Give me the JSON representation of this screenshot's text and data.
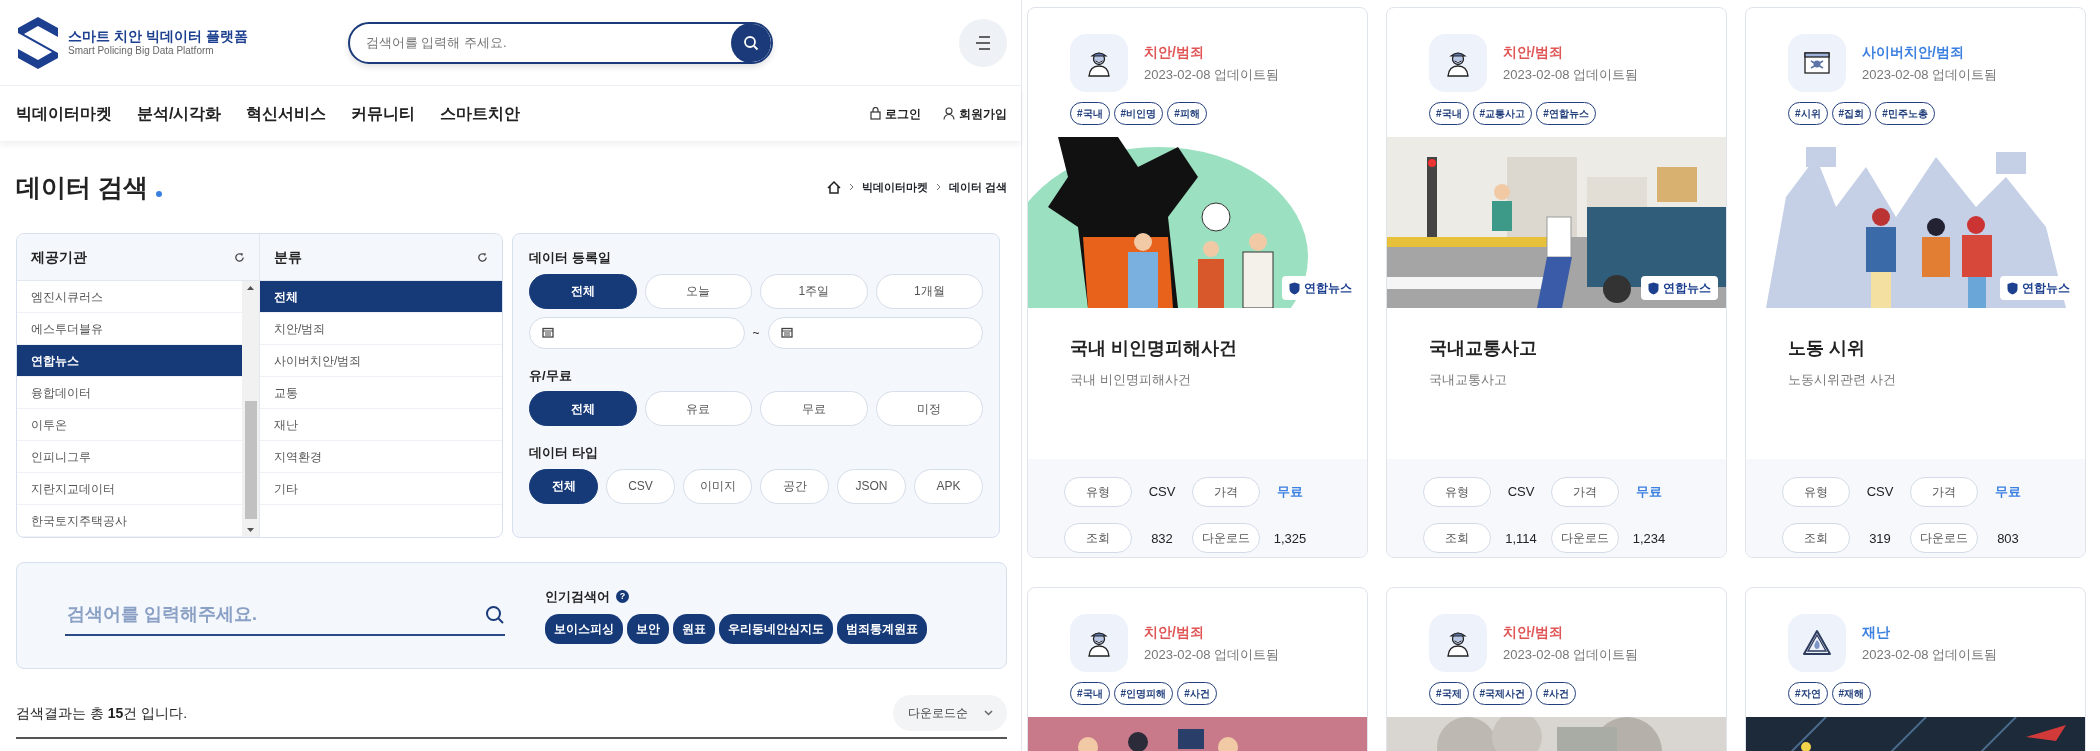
{
  "header": {
    "logo_title": "스마트 치안 빅데이터 플랫폼",
    "logo_subtitle": "Smart Policing Big Data Platform",
    "search": {
      "placeholder": "검색어를 입력해 주세요."
    }
  },
  "nav": {
    "items": [
      "빅데이터마켓",
      "분석/시각화",
      "혁신서비스",
      "커뮤니티",
      "스마트치안"
    ],
    "login": "로그인",
    "signup": "회원가입"
  },
  "page_title": "데이터 검색",
  "breadcrumb": [
    "빅데이터마켓",
    "데이터 검색"
  ],
  "providers": {
    "title": "제공기관",
    "items": [
      {
        "label": "엠진시큐러스",
        "selected": false
      },
      {
        "label": "에스투더블유",
        "selected": false
      },
      {
        "label": "연합뉴스",
        "selected": true
      },
      {
        "label": "융합데이터",
        "selected": false
      },
      {
        "label": "이투온",
        "selected": false
      },
      {
        "label": "인피니그루",
        "selected": false
      },
      {
        "label": "지란지교데이터",
        "selected": false
      },
      {
        "label": "한국토지주택공사",
        "selected": false
      }
    ]
  },
  "categories": {
    "title": "분류",
    "items": [
      {
        "label": "전체",
        "selected": true
      },
      {
        "label": "치안/범죄",
        "selected": false
      },
      {
        "label": "사이버치안/범죄",
        "selected": false
      },
      {
        "label": "교통",
        "selected": false
      },
      {
        "label": "재난",
        "selected": false
      },
      {
        "label": "지역환경",
        "selected": false
      },
      {
        "label": "기타",
        "selected": false
      }
    ]
  },
  "filters": [
    {
      "label": "데이터 등록일",
      "options": [
        {
          "label": "전체",
          "selected": true
        },
        {
          "label": "오늘",
          "selected": false
        },
        {
          "label": "1주일",
          "selected": false
        },
        {
          "label": "1개월",
          "selected": false
        }
      ],
      "range_separator": "~"
    },
    {
      "label": "유/무료",
      "options": [
        {
          "label": "전체",
          "selected": true
        },
        {
          "label": "유료",
          "selected": false
        },
        {
          "label": "무료",
          "selected": false
        },
        {
          "label": "미정",
          "selected": false
        }
      ]
    },
    {
      "label": "데이터 타입",
      "options": [
        {
          "label": "전체",
          "selected": true
        },
        {
          "label": "CSV",
          "selected": false
        },
        {
          "label": "이미지",
          "selected": false
        },
        {
          "label": "공간",
          "selected": false
        },
        {
          "label": "JSON",
          "selected": false
        },
        {
          "label": "APK",
          "selected": false
        }
      ]
    }
  ],
  "keyword_search": {
    "placeholder": "검색어를 입력해주세요.",
    "popular_label": "인기검색어",
    "help": "?",
    "popular_tags": [
      "보이스피싱",
      "보안",
      "원표",
      "우리동네안심지도",
      "범죄통계원표"
    ]
  },
  "results": {
    "summary": "검색결과는 총 **15**건 입니다.",
    "sort": "다운로드순"
  },
  "cards": [
    {
      "kind": "crime",
      "category": "치안/범죄",
      "color": "#e05555",
      "updated": "2023-02-08 업데이트됨",
      "tags": [
        "#국내",
        "#비인명",
        "#피해"
      ],
      "source": "연합뉴스",
      "title": "국내 비인명피해사건",
      "description": "국내 비인명피해사건",
      "stats": [
        {
          "label": "유형",
          "value": "CSV"
        },
        {
          "label": "가격",
          "value": "무료"
        },
        {
          "label": "조회",
          "value": "832"
        },
        {
          "label": "다운로드",
          "value": "1,325"
        }
      ]
    },
    {
      "kind": "crime",
      "category": "치안/범죄",
      "color": "#e05555",
      "updated": "2023-02-08 업데이트됨",
      "tags": [
        "#국내",
        "#교통사고",
        "#연합뉴스"
      ],
      "source": "연합뉴스",
      "title": "국내교통사고",
      "description": "국내교통사고",
      "stats": [
        {
          "label": "유형",
          "value": "CSV"
        },
        {
          "label": "가격",
          "value": "무료"
        },
        {
          "label": "조회",
          "value": "1,114"
        },
        {
          "label": "다운로드",
          "value": "1,234"
        }
      ]
    },
    {
      "kind": "cyber",
      "category": "사이버치안/범죄",
      "color": "#3b7fe0",
      "updated": "2023-02-08 업데이트됨",
      "tags": [
        "#시위",
        "#집회",
        "#민주노총"
      ],
      "source": "연합뉴스",
      "title": "노동 시위",
      "description": "노동시위관련 사건",
      "stats": [
        {
          "label": "유형",
          "value": "CSV"
        },
        {
          "label": "가격",
          "value": "무료"
        },
        {
          "label": "조회",
          "value": "319"
        },
        {
          "label": "다운로드",
          "value": "803"
        }
      ]
    },
    {
      "kind": "crime",
      "category": "치안/범죄",
      "color": "#e05555",
      "updated": "2023-02-08 업데이트됨",
      "tags": [
        "#국내",
        "#인명피해",
        "#사건"
      ]
    },
    {
      "kind": "crime",
      "category": "치안/범죄",
      "color": "#e05555",
      "updated": "2023-02-08 업데이트됨",
      "tags": [
        "#국제",
        "#국제사건",
        "#사건"
      ]
    },
    {
      "kind": "disaster",
      "category": "재난",
      "color": "#3b7fe0",
      "updated": "2023-02-08 업데이트됨",
      "tags": [
        "#자연",
        "#재해"
      ]
    }
  ]
}
